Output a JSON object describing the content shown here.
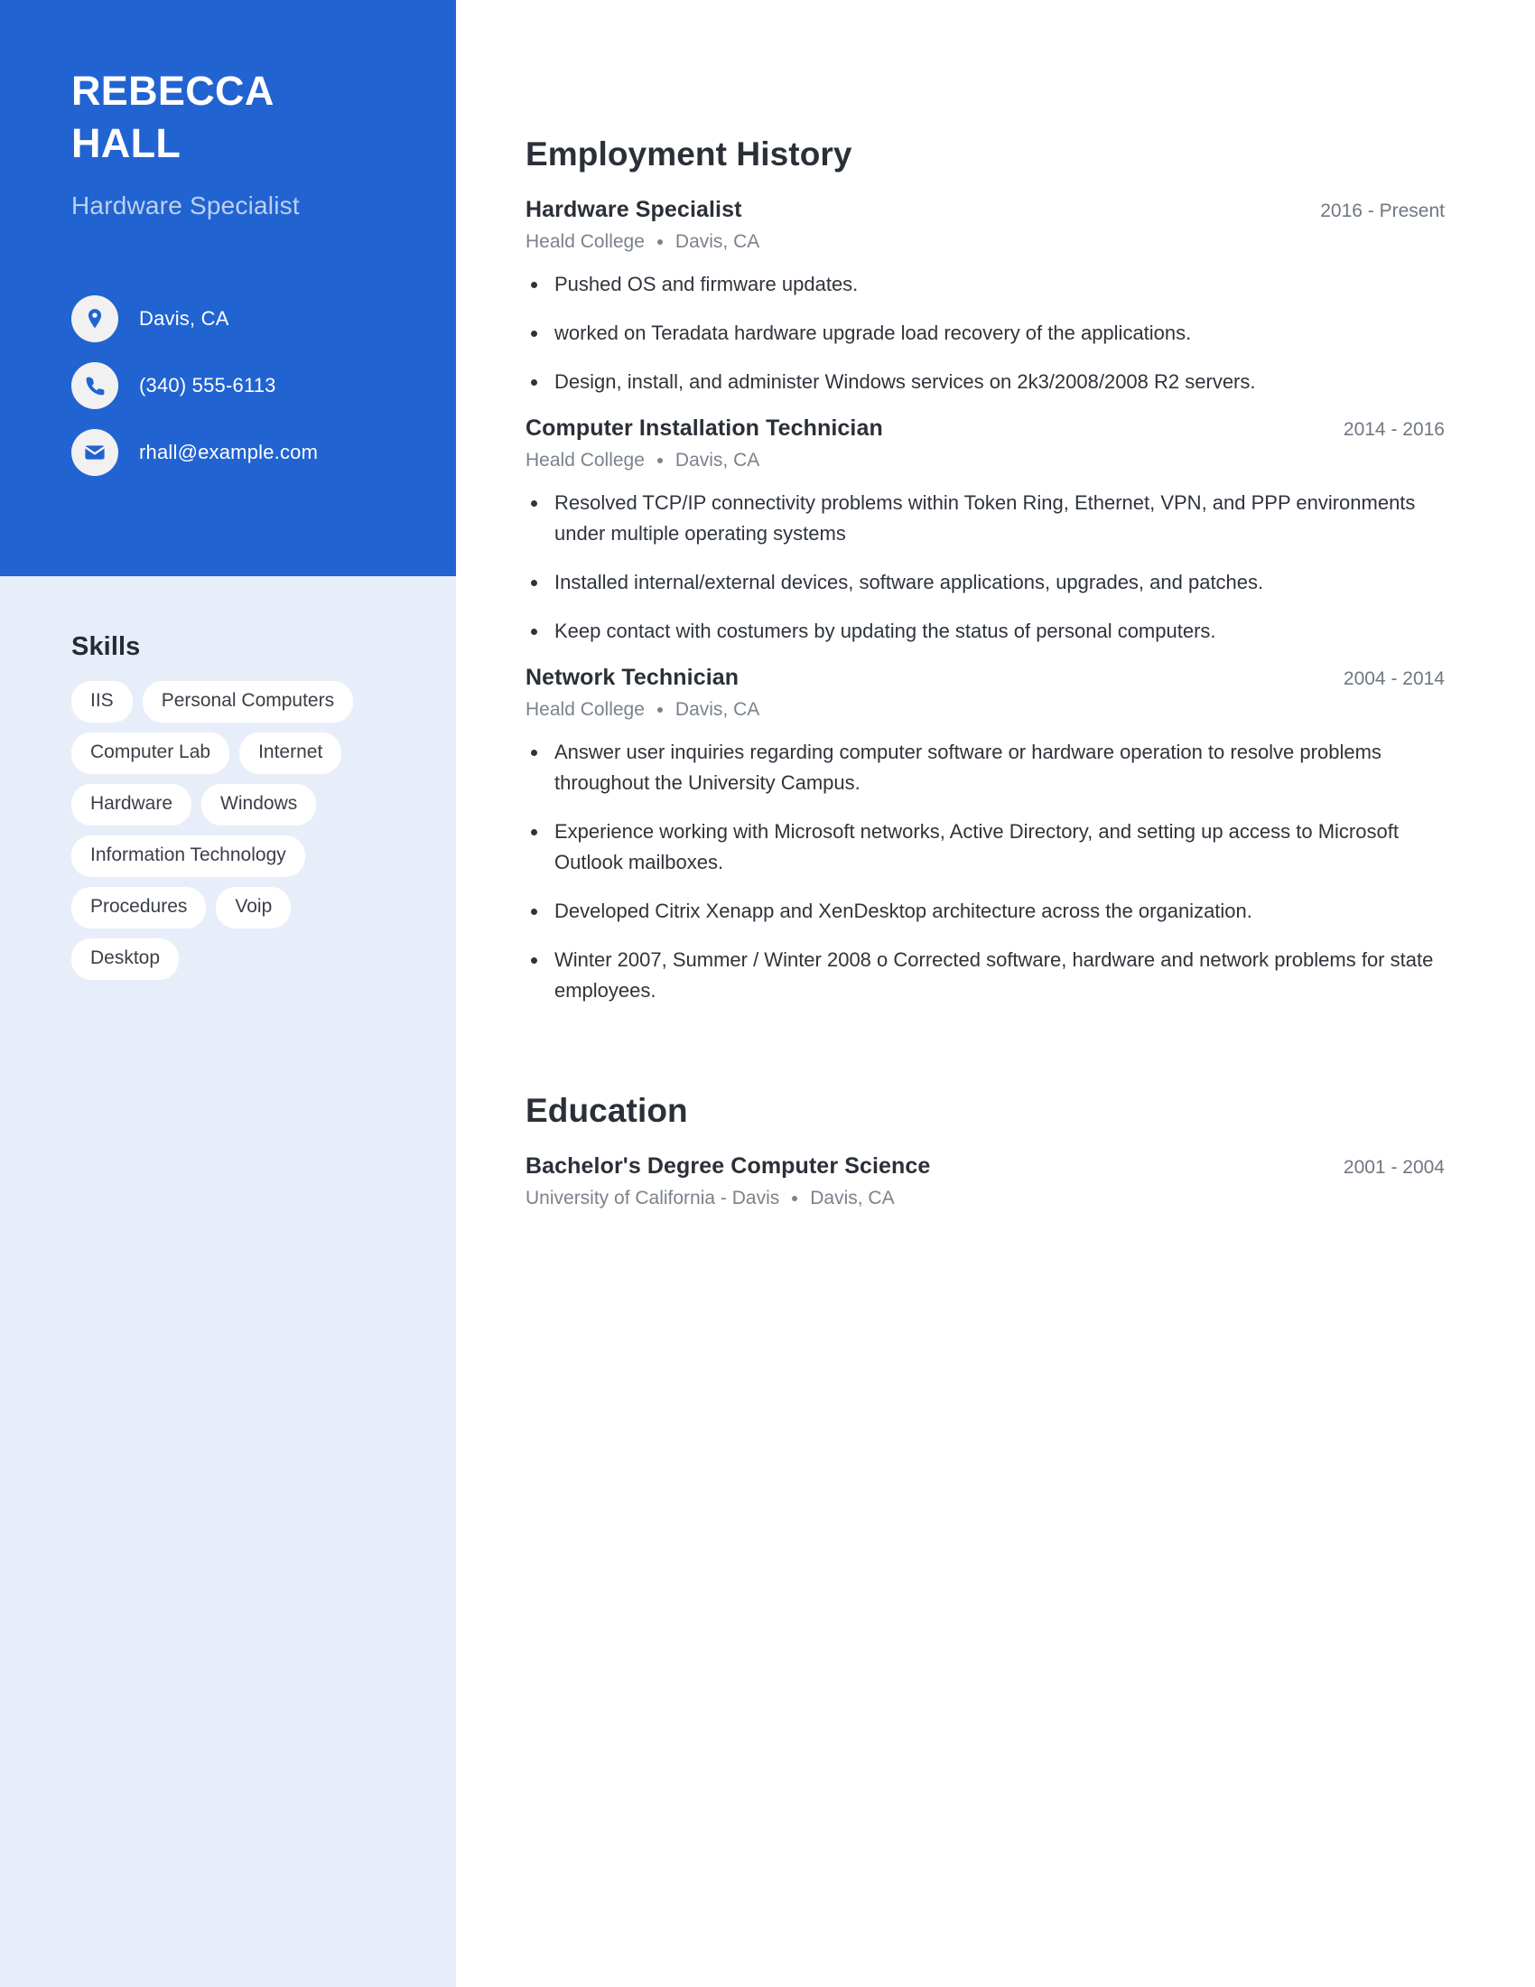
{
  "profile": {
    "first_name": "REBECCA",
    "last_name": "HALL",
    "job_title": "Hardware Specialist",
    "contacts": [
      {
        "icon": "location-pin-icon",
        "value": "Davis, CA"
      },
      {
        "icon": "phone-icon",
        "value": "(340) 555-6113"
      },
      {
        "icon": "envelope-icon",
        "value": "rhall@example.com"
      }
    ]
  },
  "skills": {
    "heading": "Skills",
    "tags": [
      "IIS",
      "Personal Computers",
      "Computer Lab",
      "Internet",
      "Hardware",
      "Windows",
      "Information Technology",
      "Procedures",
      "Voip",
      "Desktop"
    ]
  },
  "employment": {
    "heading": "Employment History",
    "entries": [
      {
        "title": "Hardware Specialist",
        "date": "2016 - Present",
        "company": "Heald College",
        "location": "Davis, CA",
        "bullets": [
          "Pushed OS and firmware updates.",
          "worked on Teradata hardware upgrade load recovery of the applications.",
          "Design, install, and administer Windows services on 2k3/2008/2008 R2 servers."
        ]
      },
      {
        "title": "Computer Installation Technician",
        "date": "2014 - 2016",
        "company": "Heald College",
        "location": "Davis, CA",
        "bullets": [
          "Resolved TCP/IP connectivity problems within Token Ring, Ethernet, VPN, and PPP environments under multiple operating systems",
          "Installed internal/external devices, software applications, upgrades, and patches.",
          "Keep contact with costumers by updating the status of personal computers."
        ]
      },
      {
        "title": "Network Technician",
        "date": "2004 - 2014",
        "company": "Heald College",
        "location": "Davis, CA",
        "bullets": [
          "Answer user inquiries regarding computer software or hardware operation to resolve problems throughout the University Campus.",
          "Experience working with Microsoft networks, Active Directory, and setting up access to Microsoft Outlook mailboxes.",
          "Developed Citrix Xenapp and XenDesktop architecture across the organization.",
          "Winter 2007, Summer / Winter 2008 o Corrected software, hardware and network problems for state employees."
        ]
      }
    ]
  },
  "education": {
    "heading": "Education",
    "entries": [
      {
        "title": "Bachelor's Degree Computer Science",
        "date": "2001 - 2004",
        "school": "University of California - Davis",
        "location": "Davis, CA"
      }
    ]
  },
  "colors": {
    "header_blue": "#2163d1",
    "sidebar_light": "#e8eef9",
    "tag_white": "#ffffff",
    "heading_dark": "#2b3038",
    "muted_gray": "#7b828c",
    "subtitle_blue": "#bcd0ee"
  }
}
